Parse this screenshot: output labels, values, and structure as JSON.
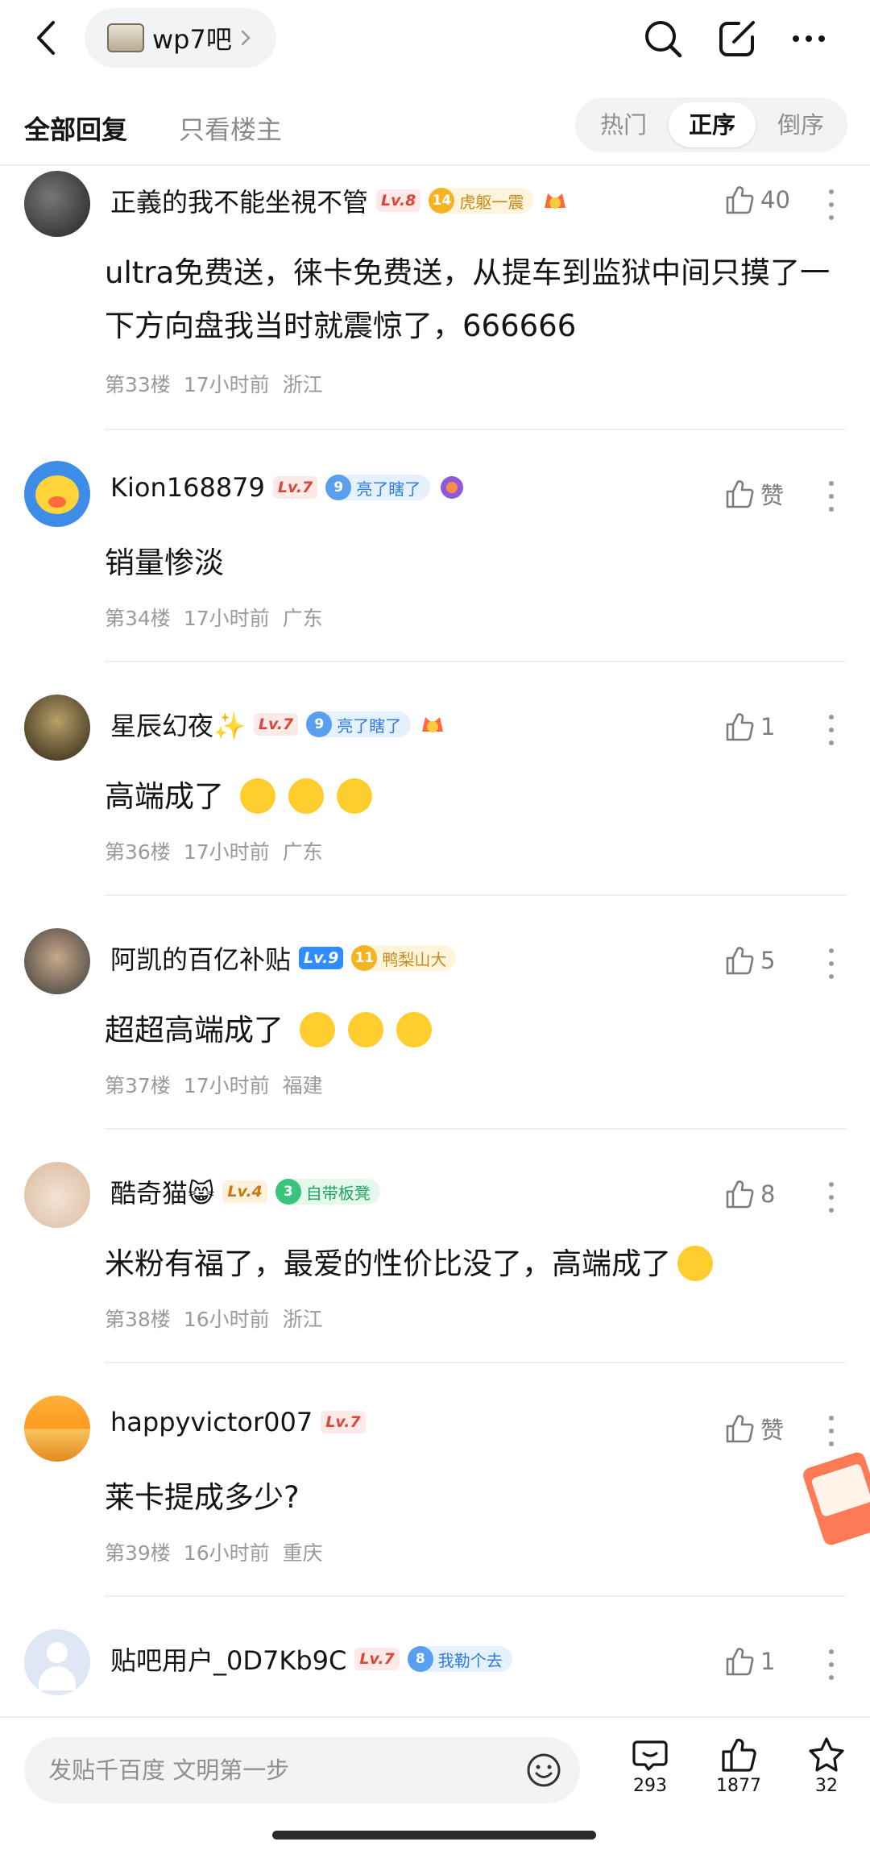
{
  "header": {
    "forum_name": "wp7吧",
    "back_icon": "back-arrow-icon",
    "search_icon": "search-icon",
    "edit_icon": "edit-icon",
    "more_icon": "more-icon"
  },
  "tabs": {
    "all": "全部回复",
    "owner": "只看楼主",
    "sort": [
      "热门",
      "正序",
      "倒序"
    ],
    "selected_sort": "正序"
  },
  "posts": [
    {
      "user": "正義的我不能坐視不管",
      "level": "Lv.8",
      "badge_num": "14",
      "badge_text": "虎躯一震",
      "likes": "40",
      "content": "ultra免费送，徕卡免费送，从提车到监狱中间只摸了一下方向盘我当时就震惊了，666666",
      "floor": "第33楼",
      "time": "17小时前",
      "location": "浙江"
    },
    {
      "user": "Kion168879",
      "level": "Lv.7",
      "badge_num": "9",
      "badge_text": "亮了瞎了",
      "likes": "赞",
      "content": "销量惨淡",
      "floor": "第34楼",
      "time": "17小时前",
      "location": "广东"
    },
    {
      "user": "星辰幻夜✨",
      "level": "Lv.7",
      "badge_num": "9",
      "badge_text": "亮了瞎了",
      "likes": "1",
      "content": "高端成了",
      "floor": "第36楼",
      "time": "17小时前",
      "location": "广东"
    },
    {
      "user": "阿凯的百亿补贴",
      "level": "Lv.9",
      "badge_num": "11",
      "badge_text": "鸭梨山大",
      "likes": "5",
      "content": "超超高端成了",
      "floor": "第37楼",
      "time": "17小时前",
      "location": "福建"
    },
    {
      "user": "酷奇猫😸",
      "level": "Lv.4",
      "badge_num": "3",
      "badge_text": "自带板凳",
      "likes": "8",
      "content": "米粉有福了，最爱的性价比没了，高端成了",
      "floor": "第38楼",
      "time": "16小时前",
      "location": "浙江"
    },
    {
      "user": "happyvictor007",
      "level": "Lv.7",
      "likes": "赞",
      "content": "莱卡提成多少?",
      "floor": "第39楼",
      "time": "16小时前",
      "location": "重庆"
    },
    {
      "user": "贴吧用户_0D7Kb9C",
      "level": "Lv.7",
      "badge_num": "8",
      "badge_text": "我勒个去",
      "likes": "1"
    }
  ],
  "bottom": {
    "placeholder": "发贴千百度 文明第一步",
    "comments": "293",
    "likes": "1877",
    "favorites": "32"
  },
  "colors": {
    "accent": "#2f8cff",
    "level_red": "#d9473a",
    "badge_gold": "#c98a15",
    "badge_blue": "#2d7be0",
    "badge_green": "#1fa460"
  }
}
